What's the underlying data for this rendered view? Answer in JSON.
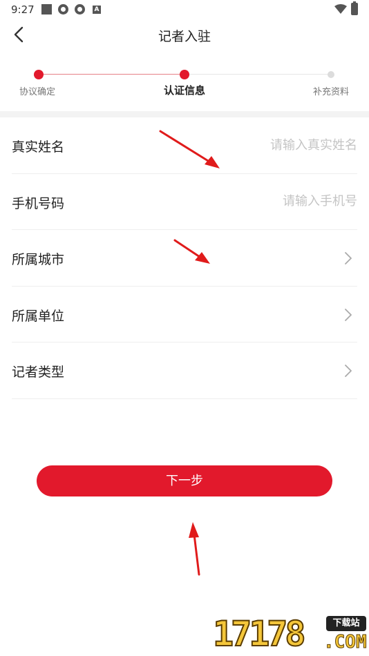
{
  "status_bar": {
    "time": "9:27",
    "badge": "A"
  },
  "nav": {
    "title": "记者入驻"
  },
  "stepper": {
    "steps": [
      {
        "label": "协议确定",
        "state": "done"
      },
      {
        "label": "认证信息",
        "state": "current"
      },
      {
        "label": "补充资料",
        "state": "pending"
      }
    ]
  },
  "form": {
    "rows": [
      {
        "label": "真实姓名",
        "type": "input",
        "placeholder": "请输入真实姓名",
        "value": ""
      },
      {
        "label": "手机号码",
        "type": "input",
        "placeholder": "请输入手机号",
        "value": ""
      },
      {
        "label": "所属城市",
        "type": "select"
      },
      {
        "label": "所属单位",
        "type": "select"
      },
      {
        "label": "记者类型",
        "type": "select"
      }
    ]
  },
  "actions": {
    "next_label": "下一步"
  },
  "watermark": {
    "digits": "17178",
    "tag": "下载站",
    "suffix": ".COM"
  },
  "colors": {
    "accent": "#e2192c",
    "placeholder": "#c4c4c4",
    "annotation_arrow": "#e01b1b"
  }
}
